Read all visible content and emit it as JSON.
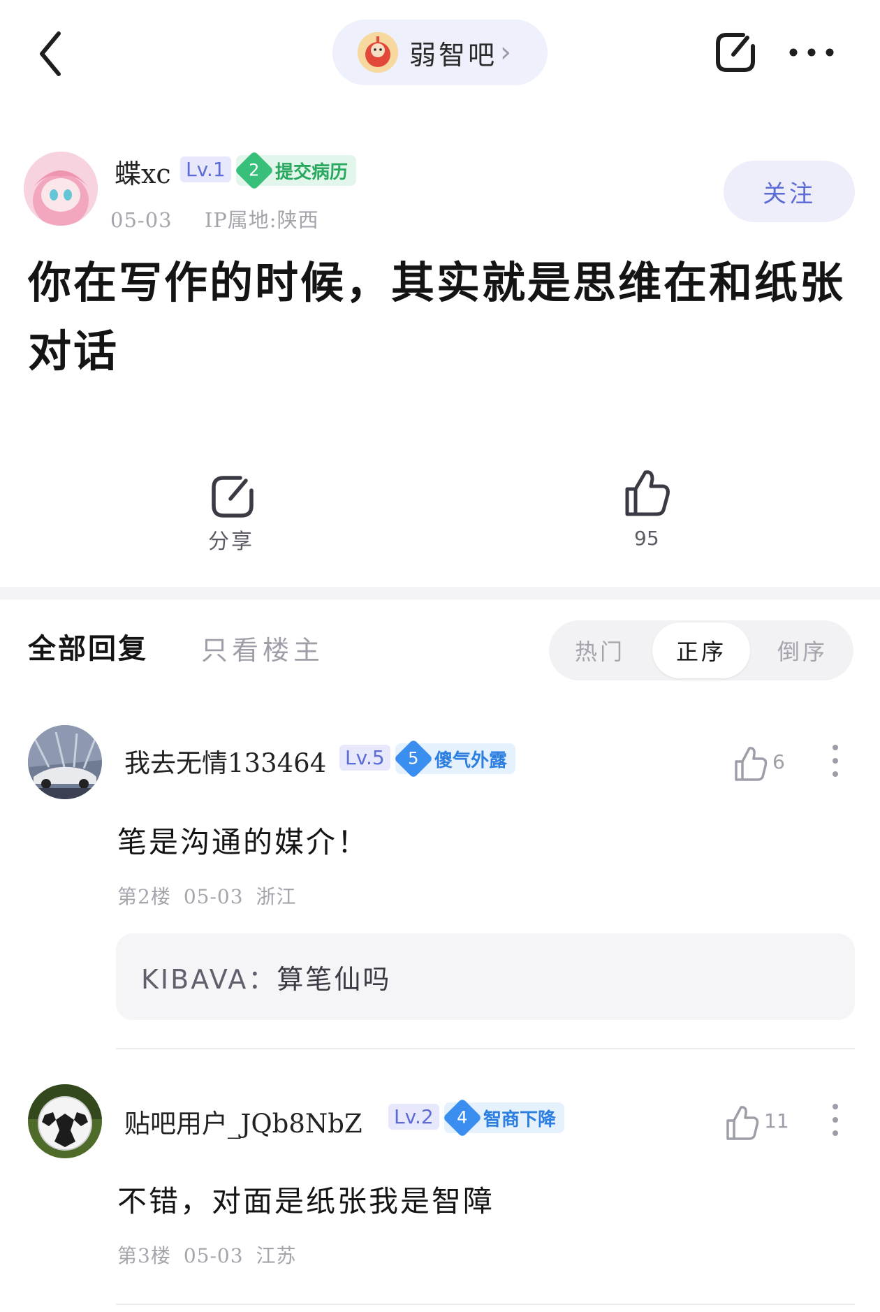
{
  "header": {
    "forum_name": "弱智吧",
    "back_icon": "chevron-left-icon",
    "share_icon": "share-icon",
    "more_icon": "more-dots-icon"
  },
  "post": {
    "author": {
      "name": "蝶xc",
      "level": "Lv.1",
      "honor_level": "2",
      "honor_title": "提交病历",
      "date": "05-03",
      "ip": "IP属地:陕西"
    },
    "follow_label": "关注",
    "title": "你在写作的时候，其实就是思维在和纸张对话",
    "share_label": "分享",
    "like_count": "95"
  },
  "tabs": {
    "all": "全部回复",
    "op_only": "只看楼主"
  },
  "sort": {
    "hot": "热门",
    "asc": "正序",
    "desc": "倒序",
    "selected": "正序"
  },
  "replies": [
    {
      "user": "我去无情133464",
      "level": "Lv.5",
      "honor_level": "5",
      "honor_title": "傻气外露",
      "likes": "6",
      "content": "笔是沟通的媒介！",
      "floor": "第2楼",
      "date": "05-03",
      "location": "浙江",
      "sub_reply": {
        "user": "KIBAVA：",
        "text": "算笔仙吗"
      }
    },
    {
      "user": "贴吧用户_JQb8NbZ",
      "level": "Lv.2",
      "honor_level": "4",
      "honor_title": "智商下降",
      "likes": "11",
      "content": "不错，对面是纸张我是智障",
      "floor": "第3楼",
      "date": "05-03",
      "location": "江苏"
    }
  ],
  "colors": {
    "accent": "#5d6bd6",
    "honor_green": "#38c07a",
    "honor_blue": "#3a8ef0",
    "meta_gray": "#a4a4ac"
  }
}
